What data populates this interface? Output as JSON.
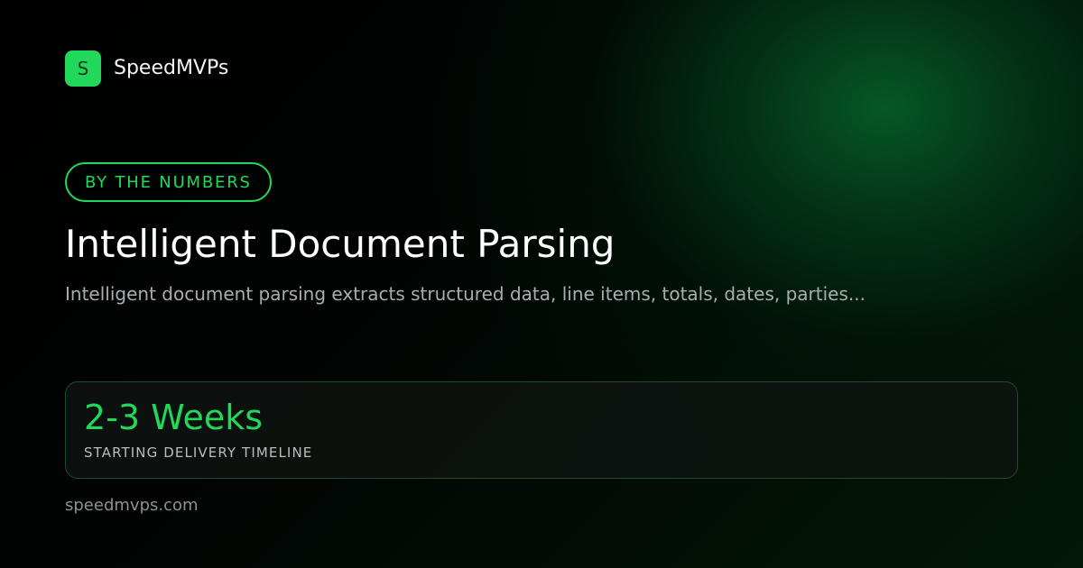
{
  "brand": {
    "mark": "S",
    "name": "SpeedMVPs"
  },
  "badge": {
    "label": "BY THE NUMBERS"
  },
  "hero": {
    "title": "Intelligent Document Parsing",
    "subtitle": "Intelligent document parsing extracts structured data, line items, totals, dates, parties..."
  },
  "stat": {
    "value": "2-3 Weeks",
    "label": "STARTING DELIVERY TIMELINE"
  },
  "footer": {
    "url": "speedmvps.com"
  },
  "colors": {
    "accent": "#22d85a",
    "background": "#000000",
    "glow": "#065c26"
  }
}
